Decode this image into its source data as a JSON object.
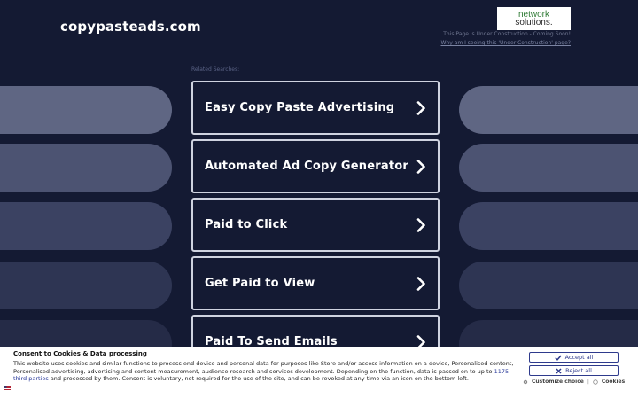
{
  "header": {
    "domain": "copypasteads.com",
    "logo_line1": "network",
    "logo_line2": "solutions.",
    "under_construction": "This Page is Under Construction - Coming Soon!",
    "why_link": "Why am I seeing this 'Under Construction' page?"
  },
  "main": {
    "related_label": "Related Searches:",
    "results": [
      {
        "label": "Easy Copy Paste Advertising"
      },
      {
        "label": "Automated Ad Copy Generator"
      },
      {
        "label": "Paid to Click"
      },
      {
        "label": "Get Paid to View"
      },
      {
        "label": "Paid To Send Emails"
      }
    ]
  },
  "consent": {
    "title": "Consent to Cookies & Data processing",
    "text_before_link": "This website uses cookies and similar functions to process end device and personal data for purposes like Store and/or access information on a device, Personalised content, Personalised advertising, advertising and content measurement, audience research and services development. Depending on the function, data is passed on to up to ",
    "link_text": "1175 third parties",
    "text_after_link": " and processed by them. Consent is voluntary, not required for the use of the site, and can be revoked at any time via an icon on the bottom left.",
    "accept_label": "Accept all",
    "reject_label": "Reject all",
    "customize_label": "Customize choice",
    "separator": "|",
    "cookies_label": "Cookies"
  },
  "colors": {
    "background": "#141a33",
    "side_pill": "#5f6683",
    "button_blue": "#2e3a8c"
  }
}
